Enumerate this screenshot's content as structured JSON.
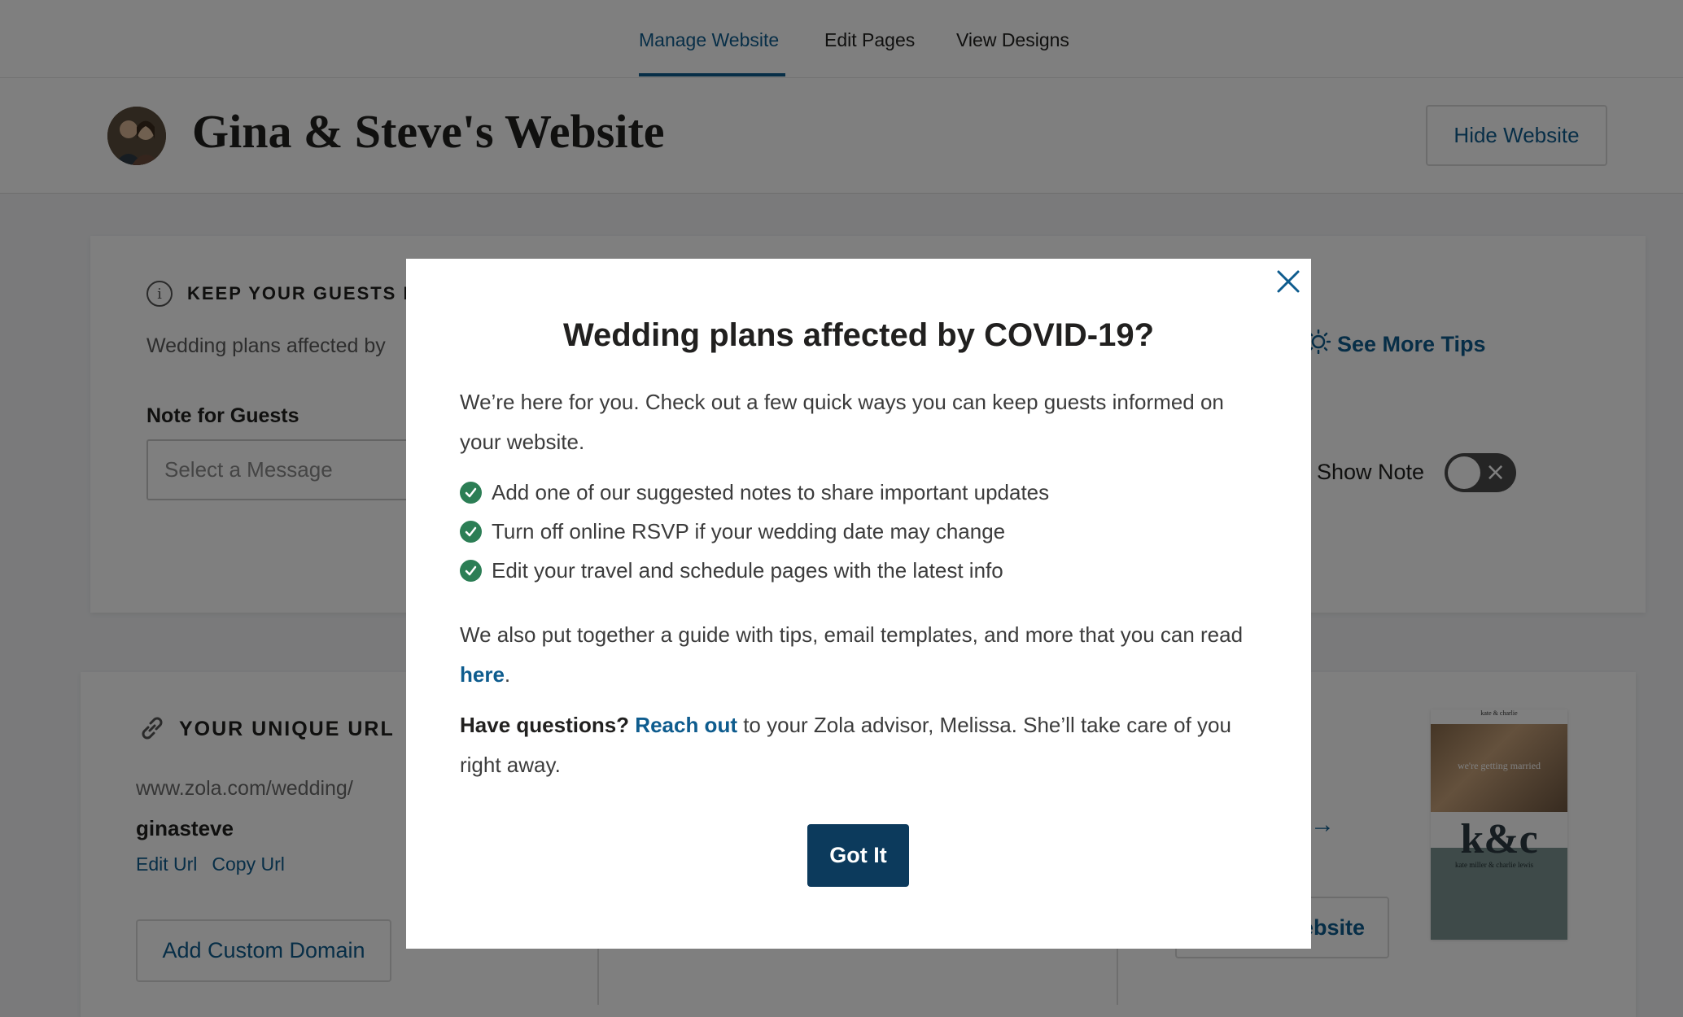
{
  "nav": {
    "tabs": [
      {
        "label": "Manage Website",
        "active": true
      },
      {
        "label": "Edit Pages",
        "active": false
      },
      {
        "label": "View Designs",
        "active": false
      }
    ]
  },
  "header": {
    "title": "Gina & Steve's Website",
    "hide_button": "Hide Website"
  },
  "covid_card": {
    "heading": "KEEP YOUR GUESTS IN",
    "description": "Wedding plans affected by",
    "note_label": "Note for Guests",
    "select_placeholder": "Select a Message",
    "tips_link": "See More Tips",
    "show_note_label": "Show Note",
    "show_note_on": false
  },
  "url_card": {
    "heading": "YOUR UNIQUE URL",
    "base_url": "www.zola.com/wedding/",
    "slug": "ginasteve",
    "edit_url": "Edit Url",
    "copy_url": "Copy Url",
    "custom_domain_button": "Add Custom Domain",
    "view_site_button": "ebsite",
    "arrow": "→",
    "preview": {
      "top_text": "kate & charlie",
      "photo_text": "we're getting married",
      "monogram": "k&c",
      "names": "kate miller & charlie lewis"
    }
  },
  "modal": {
    "close_icon": "×",
    "title": "Wedding plans affected by COVID-19?",
    "intro": "We’re here for you. Check out a few quick ways you can keep guests informed on your website.",
    "checklist": [
      "Add one of our suggested notes to share important updates",
      "Turn off online RSVP if your wedding date may change",
      "Edit your travel and schedule pages with the latest info"
    ],
    "guide_prefix": "We also put together a guide with tips, email templates, and more that you can read ",
    "guide_link": "here",
    "guide_suffix": ".",
    "questions_label": "Have questions?",
    "reach_out_link": "Reach out",
    "questions_suffix": " to your Zola advisor, Melissa. She’ll take care of you right away.",
    "button": "Got It"
  },
  "colors": {
    "accent": "#0e5c8e",
    "check": "#2c7e55",
    "primary_button": "#0c3a5c",
    "overlay": "rgba(0,0,0,0.5)"
  }
}
